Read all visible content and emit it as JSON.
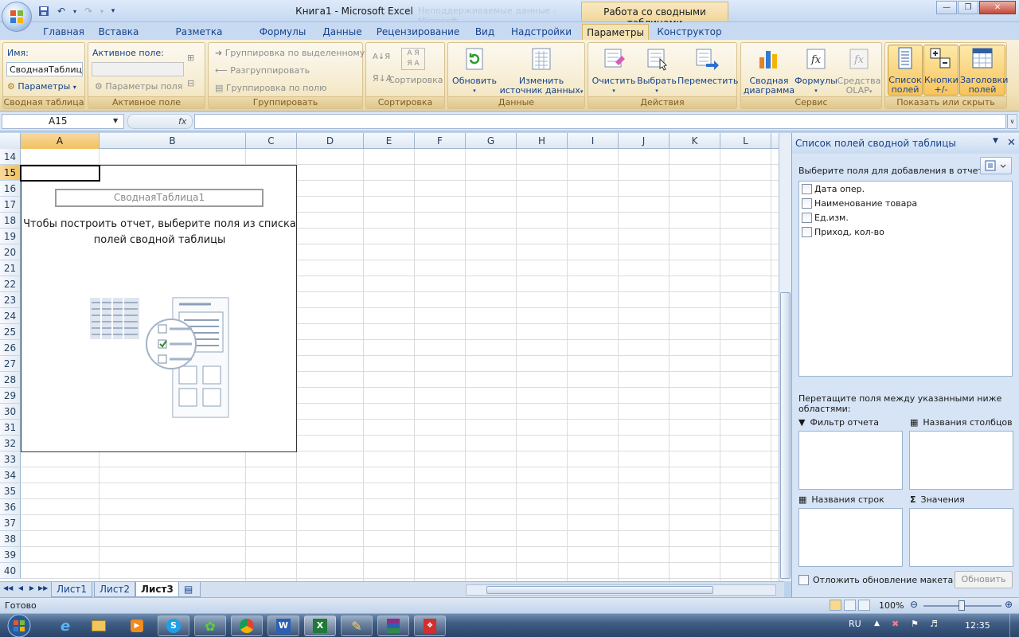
{
  "window": {
    "title": "Книга1 - Microsoft Excel",
    "context_tab_title": "Работа со сводными таблицами",
    "ghost_title": "Неподдерживаемые данные - Microsoft"
  },
  "ribbon_tabs": [
    {
      "label": "Главная"
    },
    {
      "label": "Вставка"
    },
    {
      "label": "Разметка страницы"
    },
    {
      "label": "Формулы"
    },
    {
      "label": "Данные"
    },
    {
      "label": "Рецензирование"
    },
    {
      "label": "Вид"
    },
    {
      "label": "Надстройки"
    },
    {
      "label": "Параметры",
      "active": true
    },
    {
      "label": "Конструктор"
    }
  ],
  "groups": {
    "pivot_table": {
      "label": "Сводная таблица",
      "name_label": "Имя:",
      "name_value": "СводнаяТаблица1",
      "options_label": "Параметры"
    },
    "active_field": {
      "label": "Активное поле",
      "title": "Активное поле:",
      "field_settings": "Параметры поля"
    },
    "group": {
      "label": "Группировать",
      "group_selection": "Группировка по выделенному",
      "ungroup": "Разгруппировать",
      "group_field": "Группировка по полю"
    },
    "sort": {
      "label": "Сортировка",
      "sort_label": "Сортировка"
    },
    "data": {
      "label": "Данные",
      "refresh": "Обновить",
      "change_source_1": "Изменить",
      "change_source_2": "источник данных"
    },
    "actions": {
      "label": "Действия",
      "clear": "Очистить",
      "select": "Выбрать",
      "move": "Переместить"
    },
    "tools": {
      "label": "Сервис",
      "pivot_chart_1": "Сводная",
      "pivot_chart_2": "диаграмма",
      "formulas": "Формулы",
      "olap_1": "Средства",
      "olap_2": "OLAP"
    },
    "show_hide": {
      "label": "Показать или скрыть",
      "field_list_1": "Список",
      "field_list_2": "полей",
      "buttons_1": "Кнопки",
      "buttons_2": "+/-",
      "headers_1": "Заголовки",
      "headers_2": "полей"
    }
  },
  "formula_bar": {
    "name_box": "A15",
    "fx": "fx",
    "formula": ""
  },
  "sheet": {
    "columns": [
      "A",
      "B",
      "C",
      "D",
      "E",
      "F",
      "G",
      "H",
      "I",
      "J",
      "K",
      "L"
    ],
    "rows": [
      "14",
      "15",
      "16",
      "17",
      "18",
      "19",
      "20",
      "21",
      "22",
      "23",
      "24",
      "25",
      "26",
      "27",
      "28",
      "29",
      "30",
      "31",
      "32",
      "33",
      "34",
      "35",
      "36",
      "37",
      "38",
      "39",
      "40"
    ],
    "selected_column": "A",
    "selected_row": "15"
  },
  "pivot": {
    "name": "СводнаяТаблица1",
    "hint_line1": "Чтобы построить отчет, выберите поля из списка",
    "hint_line2": "полей сводной таблицы"
  },
  "sheet_tabs": [
    "Лист1",
    "Лист2",
    "Лист3"
  ],
  "active_sheet": "Лист3",
  "field_pane": {
    "title": "Список полей сводной таблицы",
    "choose_label": "Выберите поля для добавления в отчет:",
    "fields": [
      "Дата опер.",
      "Наименование товара",
      "Ед.изм.",
      "Приход, кол-во"
    ],
    "drag_hint": "Перетащите поля между указанными ниже областями:",
    "zone_filter": "Фильтр отчета",
    "zone_columns": "Названия столбцов",
    "zone_rows": "Названия строк",
    "zone_values": "Значения",
    "defer_label": "Отложить обновление макета",
    "update_button": "Обновить"
  },
  "status": {
    "text": "Готово",
    "zoom": "100%"
  },
  "taskbar": {
    "lang": "RU",
    "time": "12:35"
  },
  "colors": {
    "accent": "#15428b",
    "ribbon_active": "#f4e3b4",
    "selection": "#f1c15f"
  }
}
